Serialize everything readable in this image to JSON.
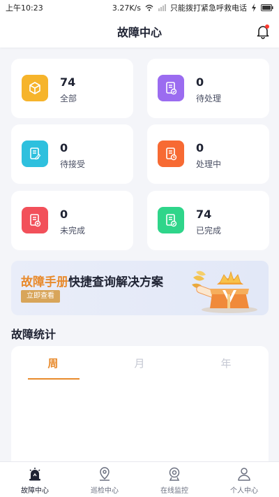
{
  "status_bar": {
    "time": "上午10:23",
    "speed": "3.27K/s",
    "carrier": "只能拨打紧急呼救电话"
  },
  "header": {
    "title": "故障中心",
    "bell_icon": "bell-icon",
    "has_notification_dot": true
  },
  "stats": [
    {
      "value": "74",
      "label": "全部",
      "color": "#f6b42b",
      "icon": "box-icon"
    },
    {
      "value": "0",
      "label": "待处理",
      "color": "#9b6cf0",
      "icon": "document-check-icon"
    },
    {
      "value": "0",
      "label": "待接受",
      "color": "#2ec0de",
      "icon": "document-edit-icon"
    },
    {
      "value": "0",
      "label": "处理中",
      "color": "#f76a33",
      "icon": "document-progress-icon"
    },
    {
      "value": "0",
      "label": "未完成",
      "color": "#f2505a",
      "icon": "document-x-icon"
    },
    {
      "value": "74",
      "label": "已完成",
      "color": "#2fd58a",
      "icon": "document-done-icon"
    }
  ],
  "banner": {
    "highlight": "故障手册",
    "text": "快捷查询解决方案",
    "button": "立即查看"
  },
  "section": {
    "title": "故障统计"
  },
  "tabs": [
    {
      "label": "周",
      "active": true
    },
    {
      "label": "月",
      "active": false
    },
    {
      "label": "年",
      "active": false
    }
  ],
  "bottom_nav": [
    {
      "label": "故障中心",
      "icon": "alarm-icon",
      "active": true
    },
    {
      "label": "巡检中心",
      "icon": "location-pin-icon",
      "active": false
    },
    {
      "label": "在线监控",
      "icon": "camera-icon",
      "active": false
    },
    {
      "label": "个人中心",
      "icon": "person-icon",
      "active": false
    }
  ]
}
